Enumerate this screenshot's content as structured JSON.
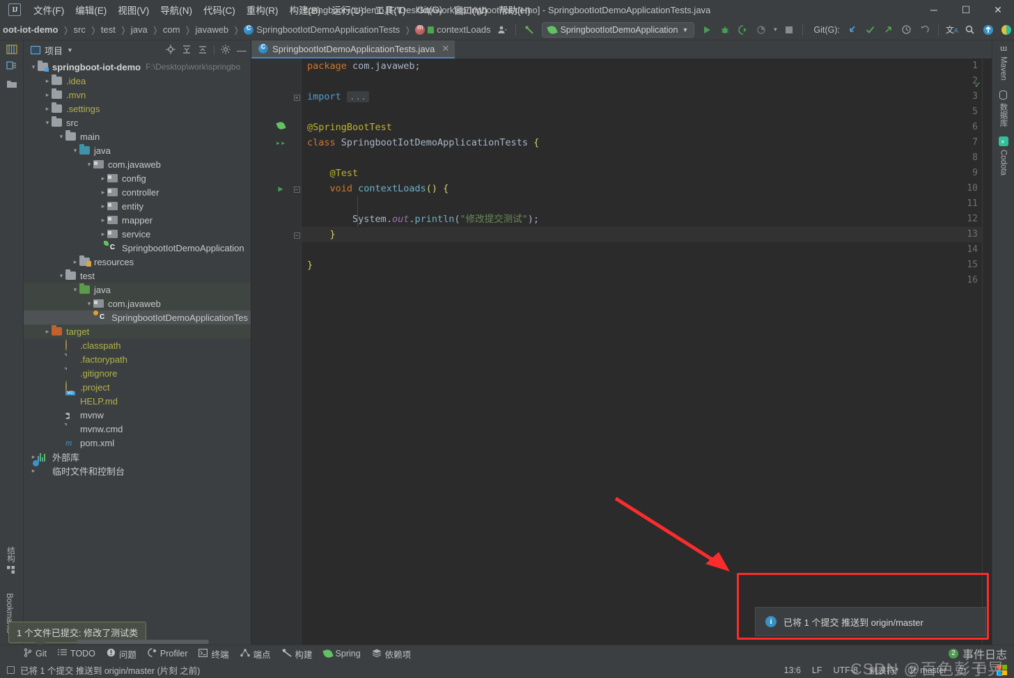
{
  "window": {
    "title": "springboot-iot-demo [F:\\Desktop\\work\\springboot-iot-demo] - SpringbootIotDemoApplicationTests.java",
    "minimize": "─",
    "maximize": "☐",
    "close": "✕"
  },
  "menu": {
    "items": [
      {
        "label": "文件(F)"
      },
      {
        "label": "编辑(E)"
      },
      {
        "label": "视图(V)"
      },
      {
        "label": "导航(N)"
      },
      {
        "label": "代码(C)"
      },
      {
        "label": "重构(R)"
      },
      {
        "label": "构建(B)"
      },
      {
        "label": "运行(U)"
      },
      {
        "label": "工具(T)"
      },
      {
        "label": "Git(G)"
      },
      {
        "label": "窗口(W)"
      },
      {
        "label": "帮助(H)"
      }
    ]
  },
  "breadcrumb": {
    "items": [
      {
        "label": "oot-iot-demo",
        "type": "project"
      },
      {
        "label": "src",
        "type": "folder"
      },
      {
        "label": "test",
        "type": "folder"
      },
      {
        "label": "java",
        "type": "folder"
      },
      {
        "label": "com",
        "type": "folder"
      },
      {
        "label": "javaweb",
        "type": "folder"
      },
      {
        "label": "SpringbootIotDemoApplicationTests",
        "type": "class"
      },
      {
        "label": "contextLoads",
        "type": "method"
      }
    ]
  },
  "toolbar": {
    "run_config": "SpringbootIotDemoApplication",
    "git_label": "Git(G):",
    "run_icon": "▶",
    "debug_icon": "🐞",
    "coverage_icon": "◑",
    "profile_icon": "◔",
    "stop_icon": "■",
    "update_icon": "↙",
    "commit_icon": "✓",
    "push_icon": "↗",
    "history_icon": "◷",
    "rollback_icon": "↺",
    "translate_icon": "文",
    "search_icon": "⌕",
    "updates_icon": "↑",
    "settings_icon": "◐",
    "user_icon": "👤",
    "build_icon": "↖"
  },
  "project_panel": {
    "title": "项目",
    "actions": [
      "target-icon",
      "collapse-all-icon",
      "expand-icon",
      "gear-icon",
      "minimize-icon"
    ],
    "tree": [
      {
        "depth": 0,
        "arrow": "open",
        "icon": "folder-module",
        "label": "springboot-iot-demo",
        "style": "bold",
        "sub": "F:\\Desktop\\work\\springbo"
      },
      {
        "depth": 1,
        "arrow": "closed",
        "icon": "folder",
        "label": ".idea",
        "style": "yellow",
        "sub": ""
      },
      {
        "depth": 1,
        "arrow": "closed",
        "icon": "folder",
        "label": ".mvn",
        "style": "yellow",
        "sub": ""
      },
      {
        "depth": 1,
        "arrow": "closed",
        "icon": "folder",
        "label": ".settings",
        "style": "yellow",
        "sub": ""
      },
      {
        "depth": 1,
        "arrow": "open",
        "icon": "folder",
        "label": "src",
        "style": "white",
        "sub": ""
      },
      {
        "depth": 2,
        "arrow": "open",
        "icon": "folder",
        "label": "main",
        "style": "white",
        "sub": ""
      },
      {
        "depth": 3,
        "arrow": "open",
        "icon": "folder-source",
        "label": "java",
        "style": "white",
        "sub": ""
      },
      {
        "depth": 4,
        "arrow": "open",
        "icon": "package",
        "label": "com.javaweb",
        "style": "white",
        "sub": ""
      },
      {
        "depth": 5,
        "arrow": "closed",
        "icon": "package",
        "label": "config",
        "style": "white",
        "sub": ""
      },
      {
        "depth": 5,
        "arrow": "closed",
        "icon": "package",
        "label": "controller",
        "style": "white",
        "sub": ""
      },
      {
        "depth": 5,
        "arrow": "closed",
        "icon": "package",
        "label": "entity",
        "style": "white",
        "sub": ""
      },
      {
        "depth": 5,
        "arrow": "closed",
        "icon": "package",
        "label": "mapper",
        "style": "white",
        "sub": ""
      },
      {
        "depth": 5,
        "arrow": "closed",
        "icon": "package",
        "label": "service",
        "style": "white",
        "sub": ""
      },
      {
        "depth": 5,
        "arrow": "none",
        "icon": "spring-class",
        "label": "SpringbootIotDemoApplication",
        "style": "white",
        "sub": ""
      },
      {
        "depth": 3,
        "arrow": "closed",
        "icon": "folder-res",
        "label": "resources",
        "style": "white",
        "sub": ""
      },
      {
        "depth": 2,
        "arrow": "open",
        "icon": "folder",
        "label": "test",
        "style": "white",
        "sub": ""
      },
      {
        "depth": 3,
        "arrow": "open",
        "icon": "folder-test",
        "label": "java",
        "style": "white",
        "sub": "",
        "rowstyle": "sel-light"
      },
      {
        "depth": 4,
        "arrow": "open",
        "icon": "package",
        "label": "com.javaweb",
        "style": "white",
        "sub": "",
        "rowstyle": "sel-light"
      },
      {
        "depth": 5,
        "arrow": "none",
        "icon": "test-class",
        "label": "SpringbootIotDemoApplicationTes",
        "style": "white",
        "sub": "",
        "rowstyle": "sel"
      },
      {
        "depth": 1,
        "arrow": "closed",
        "icon": "folder-target",
        "label": "target",
        "style": "yellow",
        "sub": "",
        "rowstyle": "sel-light"
      },
      {
        "depth": 2,
        "arrow": "none",
        "icon": "disc",
        "label": ".classpath",
        "style": "yellow",
        "sub": ""
      },
      {
        "depth": 2,
        "arrow": "none",
        "icon": "file",
        "label": ".factorypath",
        "style": "yellow",
        "sub": ""
      },
      {
        "depth": 2,
        "arrow": "none",
        "icon": "gitignore",
        "label": ".gitignore",
        "style": "yellow",
        "sub": ""
      },
      {
        "depth": 2,
        "arrow": "none",
        "icon": "disc",
        "label": ".project",
        "style": "yellow",
        "sub": ""
      },
      {
        "depth": 2,
        "arrow": "none",
        "icon": "md",
        "label": "HELP.md",
        "style": "yellow",
        "sub": ""
      },
      {
        "depth": 2,
        "arrow": "none",
        "icon": "exe",
        "label": "mvnw",
        "style": "white",
        "sub": ""
      },
      {
        "depth": 2,
        "arrow": "none",
        "icon": "file",
        "label": "mvnw.cmd",
        "style": "white",
        "sub": ""
      },
      {
        "depth": 2,
        "arrow": "none",
        "icon": "maven",
        "label": "pom.xml",
        "style": "white",
        "sub": ""
      },
      {
        "depth": 0,
        "arrow": "closed",
        "icon": "library",
        "label": "外部库",
        "style": "white",
        "sub": ""
      },
      {
        "depth": 0,
        "arrow": "closed",
        "icon": "scratch",
        "label": "临时文件和控制台",
        "style": "white",
        "sub": ""
      }
    ]
  },
  "left_strip": {
    "structure_label": "结构",
    "bookmarks_label": "Bookmarks"
  },
  "right_strip": {
    "items": [
      {
        "label": "Maven",
        "icon": "maven-icon"
      },
      {
        "label": "数据库",
        "icon": "database-icon"
      },
      {
        "label": "Codota",
        "icon": "codota-icon"
      }
    ]
  },
  "editor": {
    "tab": {
      "label": "SpringbootIotDemoApplicationTests.java",
      "close": "✕"
    },
    "lines": [
      {
        "no": "1",
        "mark": "",
        "html": "<span class=\"kw\">package</span> <span class=\"cls2\">com.javaweb</span>;"
      },
      {
        "no": "2",
        "mark": "",
        "html": ""
      },
      {
        "no": "3",
        "mark": "",
        "fold": true,
        "html": "<span class=\"kw2\">import</span> <span class=\"ellipsis\">...</span>"
      },
      {
        "no": "5",
        "mark": "",
        "html": ""
      },
      {
        "no": "6",
        "mark": "spring",
        "html": "<span class=\"ann\">@SpringBootTest</span>"
      },
      {
        "no": "7",
        "mark": "runall",
        "html": "<span class=\"kw\">class</span> <span class=\"cls2\">SpringbootIotDemoApplicationTests</span> <span class=\"brace\">{</span>"
      },
      {
        "no": "8",
        "mark": "",
        "html": ""
      },
      {
        "no": "9",
        "mark": "",
        "html": "    <span class=\"ann\">@Test</span>"
      },
      {
        "no": "10",
        "mark": "run",
        "fold2": true,
        "html": "    <span class=\"kw\">void</span> <span class=\"fn\">contextLoads</span><span class=\"brace\">()</span> <span class=\"brace\">{</span>"
      },
      {
        "no": "11",
        "mark": "",
        "html": ""
      },
      {
        "no": "12",
        "mark": "",
        "html": "        <span class=\"cls2\">System</span>.<span class=\"fld\">out</span>.<span class=\"fn\">println</span>(<span class=\"str\">\"修改提交测试\"</span>);"
      },
      {
        "no": "13",
        "mark": "",
        "fold3": true,
        "hl": true,
        "html": "    <span class=\"brace\">}</span>"
      },
      {
        "no": "14",
        "mark": "",
        "html": ""
      },
      {
        "no": "15",
        "mark": "",
        "html": "<span class=\"brace\">}</span>"
      },
      {
        "no": "16",
        "mark": "",
        "html": ""
      }
    ]
  },
  "notification": {
    "text": "已将 1 个提交 推送到 origin/master",
    "icon": "i",
    "highlight_color": "#fb2c2c"
  },
  "tooltip": {
    "text": "1 个文件已提交: 修改了测试类"
  },
  "bottom_bar": {
    "items": [
      {
        "label": "Git",
        "icon": "git-branch-icon"
      },
      {
        "label": "TODO",
        "icon": "todo-list-icon"
      },
      {
        "label": "问题",
        "icon": "problems-icon"
      },
      {
        "label": "Profiler",
        "icon": "profiler-icon"
      },
      {
        "label": "终端",
        "icon": "terminal-icon"
      },
      {
        "label": "端点",
        "icon": "endpoints-icon"
      },
      {
        "label": "构建",
        "icon": "build-icon"
      },
      {
        "label": "Spring",
        "icon": "spring-leaf-icon"
      },
      {
        "label": "依赖项",
        "icon": "dependencies-icon"
      }
    ],
    "event_log": {
      "label": "事件日志",
      "count": "2"
    }
  },
  "status_bar": {
    "message": "已将 1 个提交 推送到 origin/master (片刻 之前)",
    "caret": "13:6",
    "line_sep": "LF",
    "encoding": "UTF-8",
    "indent": "制表符*",
    "branch": "master",
    "lock_icon": "🔓",
    "watermark": "CSDN @百色彭于晃"
  }
}
